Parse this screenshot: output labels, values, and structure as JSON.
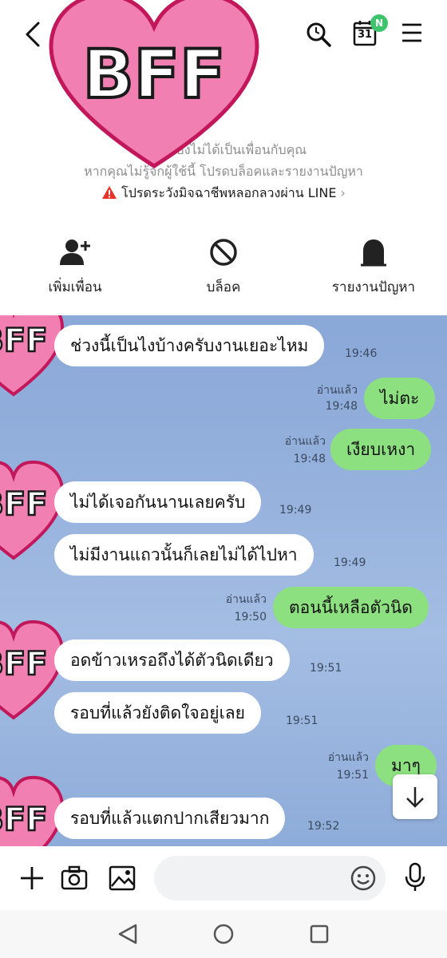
{
  "header": {
    "badge_new": "N",
    "calendar_day": "31",
    "sticker_text": "BFF"
  },
  "warning": {
    "line1": "บัญชีนี้ยังไม่ได้เป็นเพื่อนกับคุณ",
    "line2": "หากคุณไม่รู้จักผู้ใช้นี้ โปรดบล็อคและรายงานปัญหา",
    "alert": "โปรดระวังมิจฉาชีพหลอกลวงผ่าน LINE",
    "alert_chevron": "›"
  },
  "actions": {
    "add_friend": "เพิ่มเพื่อน",
    "block": "บล็อค",
    "report": "รายงานปัญหา"
  },
  "messages": [
    {
      "side": "left",
      "text": "ช่วงนี้เป็นไงบ้างครับงานเยอะไหม",
      "time": "19:46"
    },
    {
      "side": "right",
      "text": "ไม่ตะ",
      "read": "อ่านแล้ว",
      "time": "19:48"
    },
    {
      "side": "right",
      "text": "เงียบเหงา",
      "read": "อ่านแล้ว",
      "time": "19:48"
    },
    {
      "side": "left",
      "text": "ไม่ได้เจอกันนานเลยครับ",
      "time": "19:49"
    },
    {
      "side": "left",
      "text": "ไม่มีงานแถวนั้นก็เลยไม่ได้ไปหา",
      "time": "19:49"
    },
    {
      "side": "right",
      "text": "ตอนนี้เหลือตัวนิด",
      "read": "อ่านแล้ว",
      "time": "19:50"
    },
    {
      "side": "left",
      "text": "อดข้าวเหรอถึงได้ตัวนิดเดียว",
      "time": "19:51"
    },
    {
      "side": "left",
      "text": "รอบที่แล้วยังติดใจอยู่เลย",
      "time": "19:51"
    },
    {
      "side": "right",
      "text": "มาๆ",
      "read": "อ่านแล้ว",
      "time": "19:51"
    },
    {
      "side": "left",
      "text": "รอบที่แล้วแตกปากเสียวมาก",
      "time": "19:52"
    }
  ],
  "colors": {
    "chat_bg": "#8aa8d8",
    "my_bubble": "#8de07f",
    "other_bubble": "#ffffff",
    "badge_green": "#3ec46d",
    "sticker_pink": "#f27fb1"
  },
  "icons": [
    "back-icon",
    "search-icon",
    "calendar-icon",
    "menu-icon",
    "add-friend-icon",
    "block-icon",
    "report-icon",
    "plus-icon",
    "camera-icon",
    "image-icon",
    "emoji-icon",
    "mic-icon",
    "scroll-down-icon",
    "nav-back-icon",
    "nav-home-icon",
    "nav-recents-icon",
    "warning-icon"
  ]
}
